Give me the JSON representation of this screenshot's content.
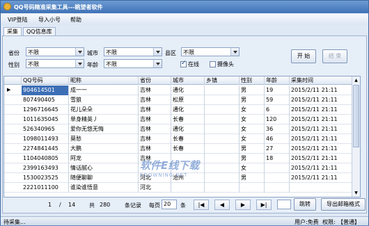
{
  "window": {
    "title": "QQ号码精准采集工具---眺望者软件"
  },
  "menu": [
    "VIP登陆",
    "导入小号",
    "帮助"
  ],
  "tabs": [
    "采集",
    "QQ信息库"
  ],
  "filters": {
    "province_label": "省份",
    "province_value": "不限",
    "city_label": "城市",
    "city_value": "不限",
    "district_label": "县区",
    "district_value": "不限",
    "gender_label": "性别",
    "gender_value": "不限",
    "age_label": "年龄",
    "age_value": "不限",
    "online_label": "在线",
    "online_checked": true,
    "camera_label": "摄像头",
    "camera_checked": false
  },
  "buttons": {
    "start": "开 始",
    "stop": "结 束"
  },
  "table": {
    "columns": [
      "QQ号码",
      "昵称",
      "省份",
      "城市",
      "乡镇",
      "性别",
      "年龄",
      "采集时间"
    ],
    "rows": [
      [
        "904614501",
        "成一一",
        "吉林",
        "通化",
        "",
        "男",
        "19",
        "2015/2/11 21:11"
      ],
      [
        "807490405",
        "雪狼",
        "吉林",
        "松原",
        "",
        "男",
        "59",
        "2015/2/11 21:11"
      ],
      [
        "1296716645",
        "花儿朵朵",
        "吉林",
        "通化",
        "",
        "女",
        "6",
        "2015/2/11 21:11"
      ],
      [
        "1011635045",
        "单身精英丿",
        "吉林",
        "长春",
        "",
        "女",
        "120",
        "2015/2/11 21:11"
      ],
      [
        "526340965",
        "爱你无悠无悔",
        "吉林",
        "通化",
        "",
        "女",
        "36",
        "2015/2/11 21:11"
      ],
      [
        "1098011493",
        "莫愁",
        "吉林",
        "长春",
        "",
        "女",
        "46",
        "2015/2/11 21:11"
      ],
      [
        "2274841445",
        "大鹏",
        "吉林",
        "长春",
        "",
        "男",
        "27",
        "2015/2/11 21:11"
      ],
      [
        "1104040805",
        "阿龙",
        "吉林",
        "",
        "",
        "男",
        "18",
        "2015/2/11 21:11"
      ],
      [
        "2399163493",
        "情话腻心",
        "",
        "",
        "",
        "女",
        "",
        "2015/2/11 21:11"
      ],
      [
        "1530023525",
        "随便聊聊",
        "河北",
        "沧州",
        "",
        "男",
        "",
        "2015/2/11 21:11"
      ],
      [
        "2221011100",
        "谁染谁悟意",
        "河北",
        "",
        "",
        "",
        "",
        ""
      ]
    ]
  },
  "watermark": {
    "main": "软件E线下载",
    "sub": "EDOWNING.NET"
  },
  "pager": {
    "current": "1",
    "sep": "/",
    "pages": "14",
    "total_prefix": "共",
    "total": "280",
    "records_label": "条记录",
    "per_page_label": "每页",
    "per_page": "20",
    "per_page_unit": "条",
    "first": "|◀",
    "prev": "◀",
    "next": "▶",
    "last": "▶|",
    "jump_value": "",
    "jump": "跳转",
    "export": "导出邮箱格式"
  },
  "status": {
    "left": "待采集...",
    "user": "用户:免费",
    "perm_label": "权限:",
    "perm": "【普通】"
  }
}
